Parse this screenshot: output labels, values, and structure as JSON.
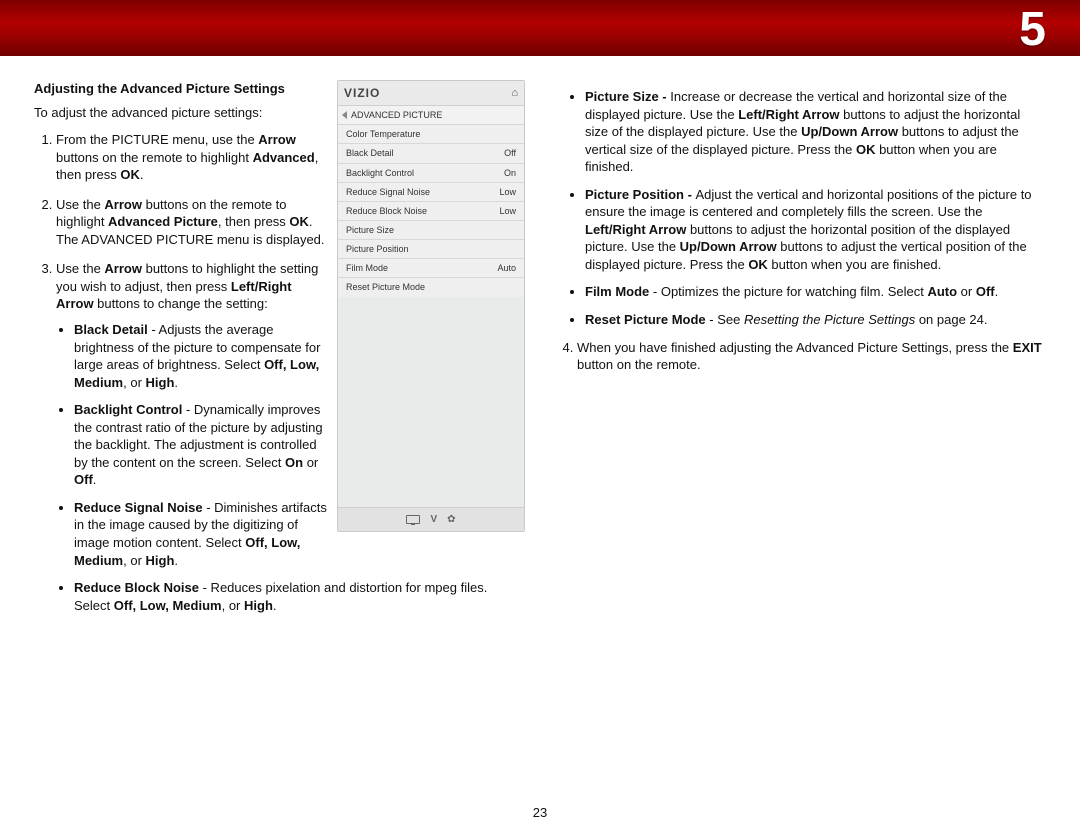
{
  "chapter": "5",
  "pageNumber": "23",
  "leftCol": {
    "heading": "Adjusting the Advanced Picture Settings",
    "intro": "To adjust the advanced picture settings:",
    "steps": [
      {
        "pre": "From the PICTURE menu, use the ",
        "b1": "Arrow",
        "mid1": " buttons on the remote to highlight ",
        "b2": "Advanced",
        "mid2": ", then press ",
        "b3": "OK",
        "post": "."
      },
      {
        "pre": "Use the ",
        "b1": "Arrow",
        "mid1": " buttons on the remote to highlight ",
        "b2": "Advanced Picture",
        "mid2": ", then press ",
        "b3": "OK",
        "plain": ". The ADVANCED PICTURE menu is displayed."
      },
      {
        "pre": "Use the ",
        "b1": "Arrow",
        "mid1": " buttons to highlight the setting you wish to adjust, then press ",
        "b2": "Left/Right Arrow",
        "post": " buttons to change the setting:"
      }
    ],
    "bullets": [
      {
        "b": "Black Detail",
        "t1": " - Adjusts the average brightness of the picture to compensate for large areas of brightness. Select ",
        "opts": "Off, Low, Medium",
        "t2": ", or ",
        "opt2": "High",
        "t3": "."
      },
      {
        "b": "Backlight Control",
        "t1": " - Dynamically improves the contrast ratio of the picture by adjusting the backlight. The adjustment is controlled by the content on the screen. Select ",
        "opts": "On",
        "t2": " or ",
        "opt2": "Off",
        "t3": "."
      },
      {
        "b": "Reduce Signal Noise",
        "t1": " - Diminishes artifacts in the image caused by the digitizing of image motion content. Select ",
        "opts": "Off, Low, Medium",
        "t2": ", or ",
        "opt2": "High",
        "t3": "."
      },
      {
        "b": "Reduce Block Noise",
        "t1": " - Reduces pixelation and distortion for mpeg files. Select ",
        "opts": "Off, Low, Medium",
        "t2": ", or ",
        "opt2": "High",
        "t3": "."
      }
    ]
  },
  "menu": {
    "brand": "VIZIO",
    "title": "ADVANCED PICTURE",
    "rows": [
      {
        "label": "Color Temperature",
        "value": ""
      },
      {
        "label": "Black Detail",
        "value": "Off"
      },
      {
        "label": "Backlight Control",
        "value": "On"
      },
      {
        "label": "Reduce Signal Noise",
        "value": "Low"
      },
      {
        "label": "Reduce Block Noise",
        "value": "Low"
      },
      {
        "label": "Picture Size",
        "value": ""
      },
      {
        "label": "Picture Position",
        "value": ""
      },
      {
        "label": "Film Mode",
        "value": "Auto"
      },
      {
        "label": "Reset Picture Mode",
        "value": ""
      }
    ]
  },
  "rightCol": {
    "bullets": [
      {
        "b": "Picture Size - ",
        "segments": [
          {
            "t": "Increase or decrease the vertical and horizontal size of the displayed picture. Use the "
          },
          {
            "b": "Left/Right Arrow"
          },
          {
            "t": " buttons to adjust the horizontal size of the displayed picture. Use the "
          },
          {
            "b": "Up/Down Arrow"
          },
          {
            "t": " buttons to adjust the vertical size of the displayed picture. Press the "
          },
          {
            "b": "OK"
          },
          {
            "t": " button when you are finished."
          }
        ]
      },
      {
        "b": "Picture Position - ",
        "segments": [
          {
            "t": "Adjust the vertical and horizontal positions of the picture to ensure the image is centered and completely fills the screen. Use the "
          },
          {
            "b": "Left/Right Arrow"
          },
          {
            "t": " buttons to adjust the horizontal position of the displayed picture. Use the "
          },
          {
            "b": "Up/Down Arrow"
          },
          {
            "t": " buttons to adjust the vertical position of the displayed picture. Press the "
          },
          {
            "b": "OK"
          },
          {
            "t": " button when you are finished."
          }
        ]
      },
      {
        "b": "Film Mode",
        "segments": [
          {
            "t": " - Optimizes the picture for watching film. Select "
          },
          {
            "b": "Auto"
          },
          {
            "t": " or "
          },
          {
            "b": "Off"
          },
          {
            "t": "."
          }
        ]
      },
      {
        "b": "Reset Picture Mode",
        "segments": [
          {
            "t": " - See "
          },
          {
            "i": "Resetting the Picture Settings"
          },
          {
            "t": " on page 24."
          }
        ]
      }
    ],
    "step4": {
      "pre": "When you have finished adjusting the Advanced Picture Settings, press the ",
      "b": "EXIT",
      "post": " button on the remote."
    }
  }
}
